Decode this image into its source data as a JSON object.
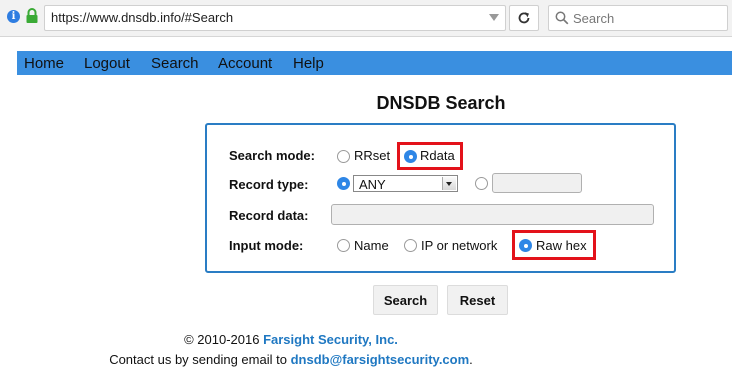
{
  "browser": {
    "url": "https://www.dnsdb.info/#Search",
    "search_placeholder": "Search"
  },
  "nav": {
    "items": [
      "Home",
      "Logout",
      "Search",
      "Account",
      "Help"
    ]
  },
  "page": {
    "title": "DNSDB Search"
  },
  "form": {
    "search_mode": {
      "label": "Search mode:",
      "options": [
        "RRset",
        "Rdata"
      ],
      "selected": "Rdata"
    },
    "record_type": {
      "label": "Record type:",
      "selected_value": "ANY",
      "custom_value": ""
    },
    "record_data": {
      "label": "Record data:",
      "value": ""
    },
    "input_mode": {
      "label": "Input mode:",
      "options": [
        "Name",
        "IP or network",
        "Raw hex"
      ],
      "selected": "Raw hex"
    }
  },
  "buttons": {
    "search": "Search",
    "reset": "Reset"
  },
  "footer": {
    "copyright_prefix": "© 2010-2016 ",
    "company": "Farsight Security, Inc.",
    "contact_prefix": "Contact us by sending email to ",
    "email": "dnsdb@farsightsecurity.com",
    "contact_suffix": "."
  },
  "colors": {
    "nav_bar": "#3a8fe0",
    "form_border": "#2a7dc4",
    "highlight": "#e3121a",
    "link": "#1f78c2",
    "radio_checked": "#2e86e6"
  }
}
